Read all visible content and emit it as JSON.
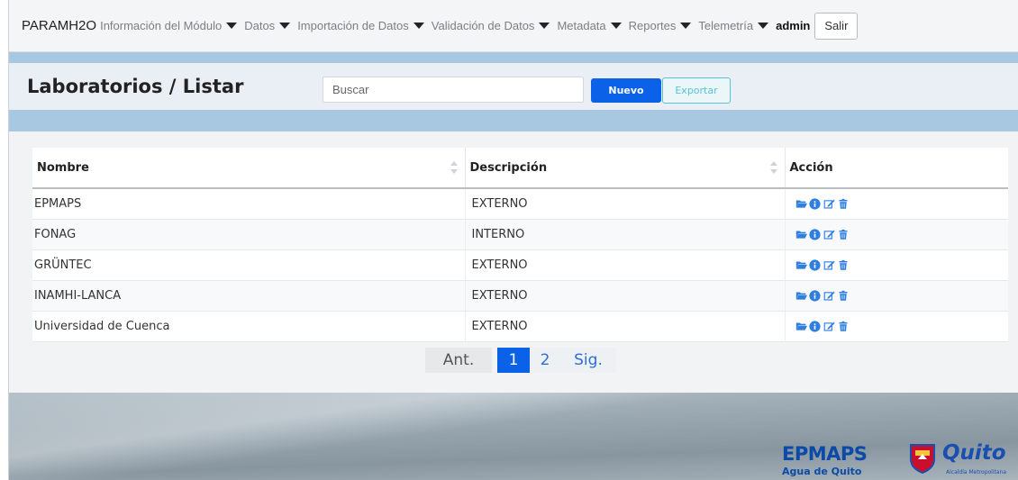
{
  "navbar": {
    "brand": "PARAMH2O",
    "items": [
      {
        "label": "Información del Módulo"
      },
      {
        "label": "Datos"
      },
      {
        "label": "Importación de Datos"
      },
      {
        "label": "Validación de Datos"
      },
      {
        "label": "Metadata"
      },
      {
        "label": "Reportes"
      },
      {
        "label": "Telemetría"
      }
    ],
    "user": "admin",
    "logout_label": "Salir"
  },
  "toolbar": {
    "title": "Laboratorios / Listar",
    "search_placeholder": "Buscar",
    "new_label": "Nuevo",
    "export_label": "Exportar"
  },
  "table": {
    "headers": [
      "Nombre",
      "Descripción",
      "Acción"
    ],
    "rows": [
      {
        "nombre": "EPMAPS",
        "descripcion": "EXTERNO"
      },
      {
        "nombre": "FONAG",
        "descripcion": "INTERNO"
      },
      {
        "nombre": "GRÜNTEC",
        "descripcion": "EXTERNO"
      },
      {
        "nombre": "INAMHI-LANCA",
        "descripcion": "EXTERNO"
      },
      {
        "nombre": "Universidad de Cuenca",
        "descripcion": "EXTERNO"
      }
    ],
    "row_actions": [
      "folder-open-icon",
      "info-icon",
      "edit-icon",
      "trash-icon"
    ]
  },
  "pagination": {
    "prev_label": "Ant.",
    "pages": [
      "1",
      "2"
    ],
    "current_page": "1",
    "next_label": "Sig."
  },
  "footer": {
    "logo_name": "EPMAPS",
    "logo_tagline": "Agua de Quito",
    "city_logo": "Quito",
    "city_sub": "Alcaldía Metropolitana"
  },
  "colors": {
    "primary": "#0b61e8",
    "info": "#59c2d4",
    "band": "#a8c7e1",
    "action_icons": "#2f7fe0"
  }
}
